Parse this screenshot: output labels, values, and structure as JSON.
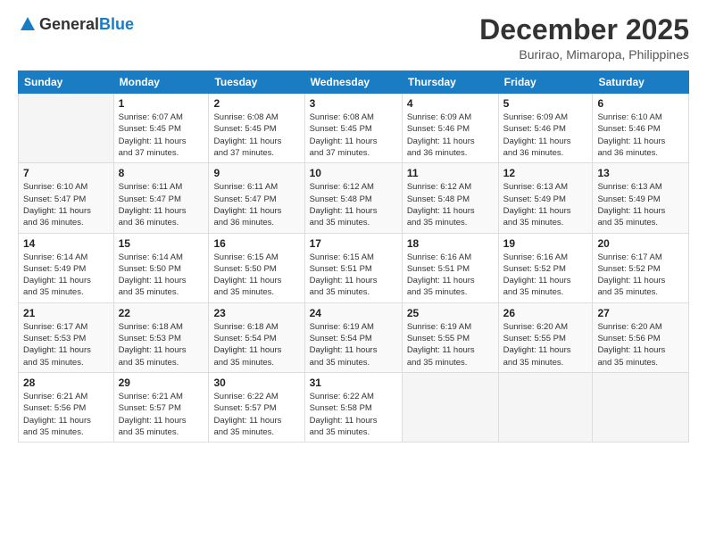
{
  "header": {
    "logo": {
      "general": "General",
      "blue": "Blue"
    },
    "title": "December 2025",
    "location": "Burirao, Mimaropa, Philippines"
  },
  "weekdays": [
    "Sunday",
    "Monday",
    "Tuesday",
    "Wednesday",
    "Thursday",
    "Friday",
    "Saturday"
  ],
  "weeks": [
    [
      {
        "day": "",
        "info": ""
      },
      {
        "day": "1",
        "info": "Sunrise: 6:07 AM\nSunset: 5:45 PM\nDaylight: 11 hours\nand 37 minutes."
      },
      {
        "day": "2",
        "info": "Sunrise: 6:08 AM\nSunset: 5:45 PM\nDaylight: 11 hours\nand 37 minutes."
      },
      {
        "day": "3",
        "info": "Sunrise: 6:08 AM\nSunset: 5:45 PM\nDaylight: 11 hours\nand 37 minutes."
      },
      {
        "day": "4",
        "info": "Sunrise: 6:09 AM\nSunset: 5:46 PM\nDaylight: 11 hours\nand 36 minutes."
      },
      {
        "day": "5",
        "info": "Sunrise: 6:09 AM\nSunset: 5:46 PM\nDaylight: 11 hours\nand 36 minutes."
      },
      {
        "day": "6",
        "info": "Sunrise: 6:10 AM\nSunset: 5:46 PM\nDaylight: 11 hours\nand 36 minutes."
      }
    ],
    [
      {
        "day": "7",
        "info": "Sunrise: 6:10 AM\nSunset: 5:47 PM\nDaylight: 11 hours\nand 36 minutes."
      },
      {
        "day": "8",
        "info": "Sunrise: 6:11 AM\nSunset: 5:47 PM\nDaylight: 11 hours\nand 36 minutes."
      },
      {
        "day": "9",
        "info": "Sunrise: 6:11 AM\nSunset: 5:47 PM\nDaylight: 11 hours\nand 36 minutes."
      },
      {
        "day": "10",
        "info": "Sunrise: 6:12 AM\nSunset: 5:48 PM\nDaylight: 11 hours\nand 35 minutes."
      },
      {
        "day": "11",
        "info": "Sunrise: 6:12 AM\nSunset: 5:48 PM\nDaylight: 11 hours\nand 35 minutes."
      },
      {
        "day": "12",
        "info": "Sunrise: 6:13 AM\nSunset: 5:49 PM\nDaylight: 11 hours\nand 35 minutes."
      },
      {
        "day": "13",
        "info": "Sunrise: 6:13 AM\nSunset: 5:49 PM\nDaylight: 11 hours\nand 35 minutes."
      }
    ],
    [
      {
        "day": "14",
        "info": "Sunrise: 6:14 AM\nSunset: 5:49 PM\nDaylight: 11 hours\nand 35 minutes."
      },
      {
        "day": "15",
        "info": "Sunrise: 6:14 AM\nSunset: 5:50 PM\nDaylight: 11 hours\nand 35 minutes."
      },
      {
        "day": "16",
        "info": "Sunrise: 6:15 AM\nSunset: 5:50 PM\nDaylight: 11 hours\nand 35 minutes."
      },
      {
        "day": "17",
        "info": "Sunrise: 6:15 AM\nSunset: 5:51 PM\nDaylight: 11 hours\nand 35 minutes."
      },
      {
        "day": "18",
        "info": "Sunrise: 6:16 AM\nSunset: 5:51 PM\nDaylight: 11 hours\nand 35 minutes."
      },
      {
        "day": "19",
        "info": "Sunrise: 6:16 AM\nSunset: 5:52 PM\nDaylight: 11 hours\nand 35 minutes."
      },
      {
        "day": "20",
        "info": "Sunrise: 6:17 AM\nSunset: 5:52 PM\nDaylight: 11 hours\nand 35 minutes."
      }
    ],
    [
      {
        "day": "21",
        "info": "Sunrise: 6:17 AM\nSunset: 5:53 PM\nDaylight: 11 hours\nand 35 minutes."
      },
      {
        "day": "22",
        "info": "Sunrise: 6:18 AM\nSunset: 5:53 PM\nDaylight: 11 hours\nand 35 minutes."
      },
      {
        "day": "23",
        "info": "Sunrise: 6:18 AM\nSunset: 5:54 PM\nDaylight: 11 hours\nand 35 minutes."
      },
      {
        "day": "24",
        "info": "Sunrise: 6:19 AM\nSunset: 5:54 PM\nDaylight: 11 hours\nand 35 minutes."
      },
      {
        "day": "25",
        "info": "Sunrise: 6:19 AM\nSunset: 5:55 PM\nDaylight: 11 hours\nand 35 minutes."
      },
      {
        "day": "26",
        "info": "Sunrise: 6:20 AM\nSunset: 5:55 PM\nDaylight: 11 hours\nand 35 minutes."
      },
      {
        "day": "27",
        "info": "Sunrise: 6:20 AM\nSunset: 5:56 PM\nDaylight: 11 hours\nand 35 minutes."
      }
    ],
    [
      {
        "day": "28",
        "info": "Sunrise: 6:21 AM\nSunset: 5:56 PM\nDaylight: 11 hours\nand 35 minutes."
      },
      {
        "day": "29",
        "info": "Sunrise: 6:21 AM\nSunset: 5:57 PM\nDaylight: 11 hours\nand 35 minutes."
      },
      {
        "day": "30",
        "info": "Sunrise: 6:22 AM\nSunset: 5:57 PM\nDaylight: 11 hours\nand 35 minutes."
      },
      {
        "day": "31",
        "info": "Sunrise: 6:22 AM\nSunset: 5:58 PM\nDaylight: 11 hours\nand 35 minutes."
      },
      {
        "day": "",
        "info": ""
      },
      {
        "day": "",
        "info": ""
      },
      {
        "day": "",
        "info": ""
      }
    ]
  ]
}
